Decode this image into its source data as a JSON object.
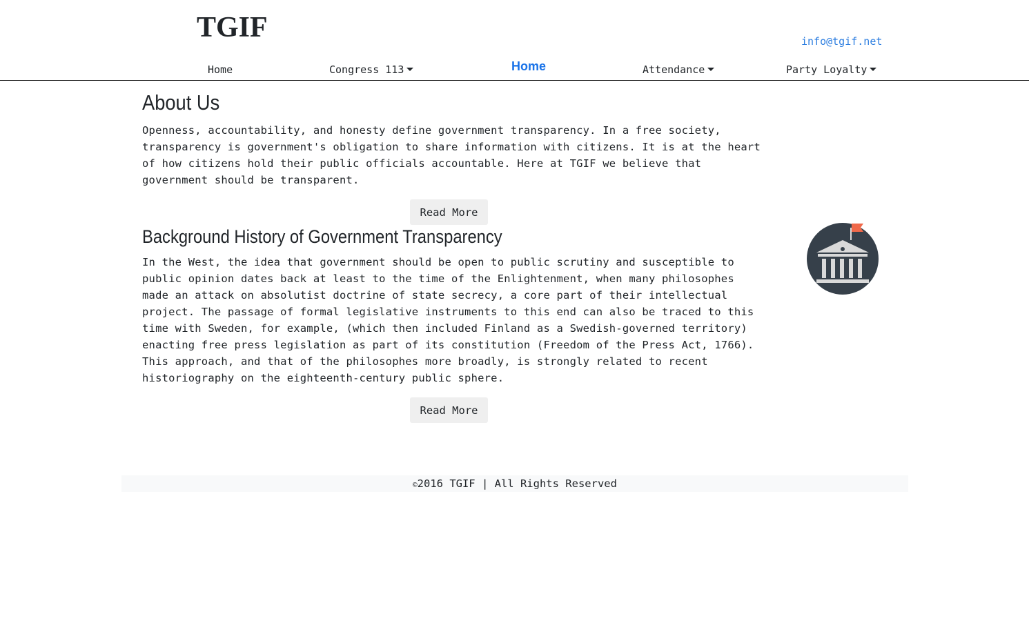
{
  "header": {
    "brand": "TGIF",
    "email": "info@tgif.net"
  },
  "nav": {
    "home": "Home",
    "congress": "Congress 113",
    "center_home": "Home",
    "attendance": "Attendance",
    "party_loyalty": "Party Loyalty"
  },
  "about": {
    "title": "About Us",
    "text": "Openness, accountability, and honesty define government transparency. In a free society, transparency is government's obligation to share information with citizens. It is at the heart of how citizens hold their public officials accountable. Here at TGIF we believe that government should be transparent.",
    "button": "Read More"
  },
  "history": {
    "title": "Background History of Government Transparency",
    "text": "In the West, the idea that government should be open to public scrutiny and susceptible to public opinion dates back at least to the time of the Enlightenment, when many philosophes made an attack on absolutist doctrine of state secrecy, a core part of their intellectual project. The passage of formal legislative instruments to this end can also be traced to this time with Sweden, for example, (which then included Finland as a Swedish-governed territory) enacting free press legislation as part of its constitution (Freedom of the Press Act, 1766). This approach, and that of the philosophes more broadly, is strongly related to recent historiography on the eighteenth-century public sphere.",
    "button": "Read More"
  },
  "sidebar": {
    "logo_icon": "government-building-icon"
  },
  "footer": {
    "copyright_symbol": "©",
    "text": "2016 TGIF | All Rights Reserved"
  },
  "colors": {
    "link": "#2d7ee0",
    "active_nav": "#1a73e8",
    "logo_circle": "#36404a",
    "flag": "#f0694a",
    "footer_bg": "#f8f9fa"
  }
}
